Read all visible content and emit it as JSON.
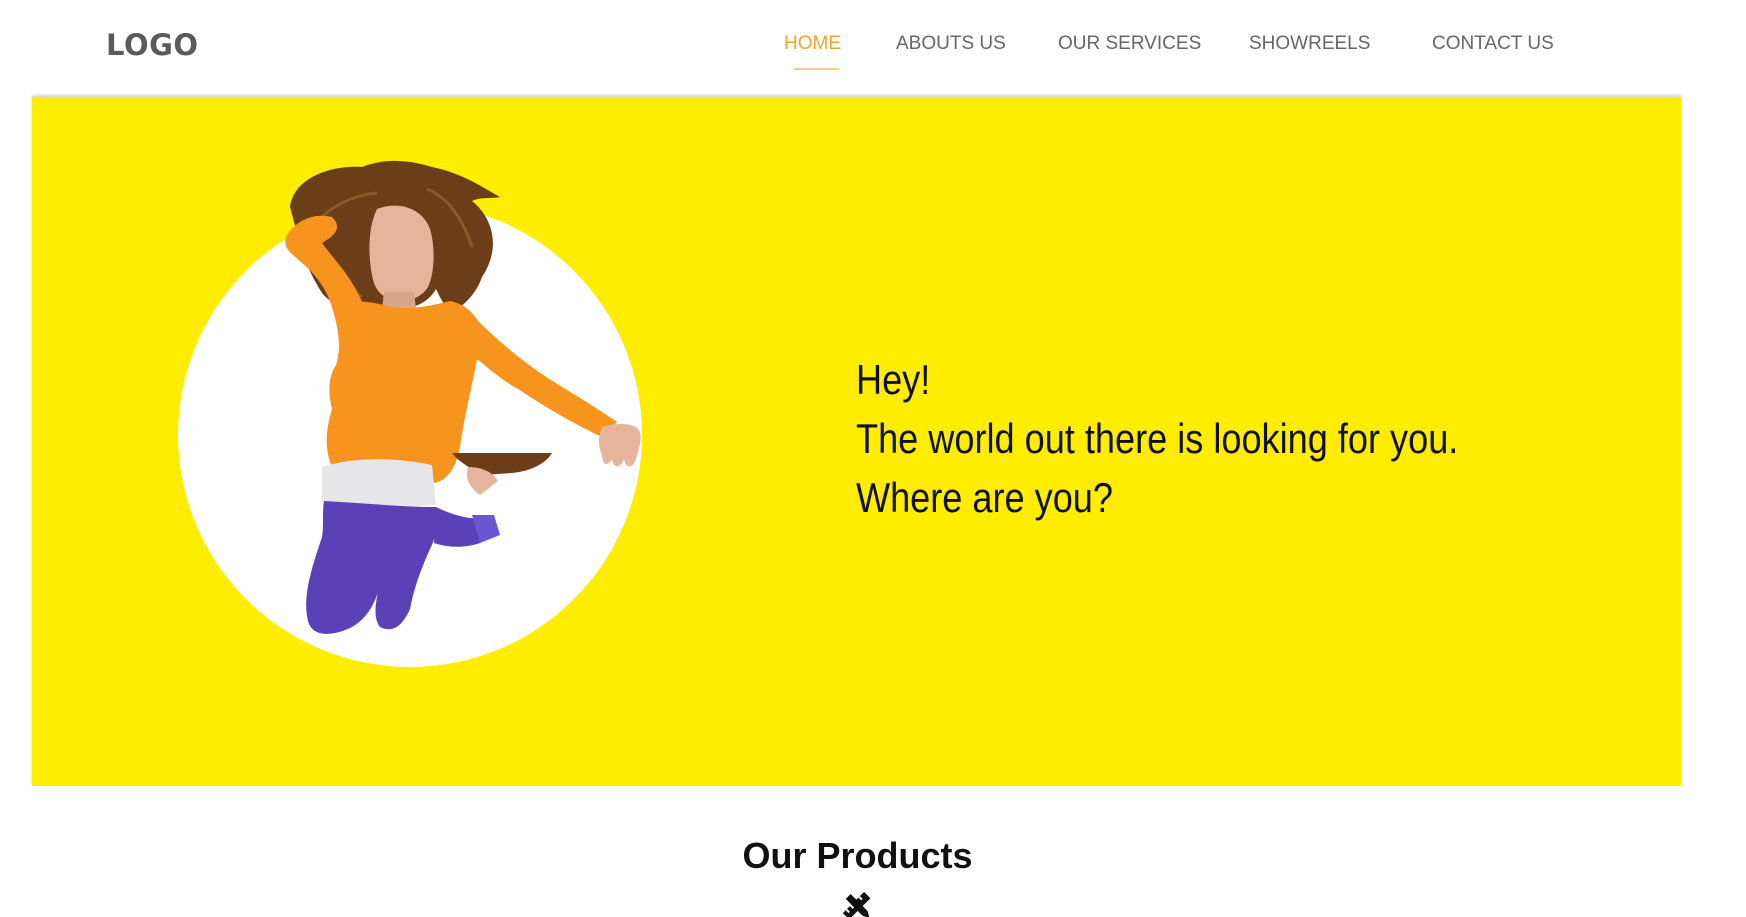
{
  "header": {
    "logo": "LOGO",
    "nav": [
      {
        "label": "HOME",
        "active": true
      },
      {
        "label": "ABOUTS US",
        "active": false
      },
      {
        "label": "OUR SERVICES",
        "active": false
      },
      {
        "label": "SHOWREELS",
        "active": false
      },
      {
        "label": "CONTACT US",
        "active": false
      }
    ]
  },
  "hero": {
    "background_color": "#ffed00",
    "lines": [
      "Hey!",
      "The world out there is looking for you.",
      "Where are you?"
    ]
  },
  "products": {
    "title": "Our Products",
    "icon": "pencil-ruler-icon"
  },
  "colors": {
    "accent": "#f5a32b",
    "nav_text": "#666666",
    "logo": "#5a5a5a"
  }
}
